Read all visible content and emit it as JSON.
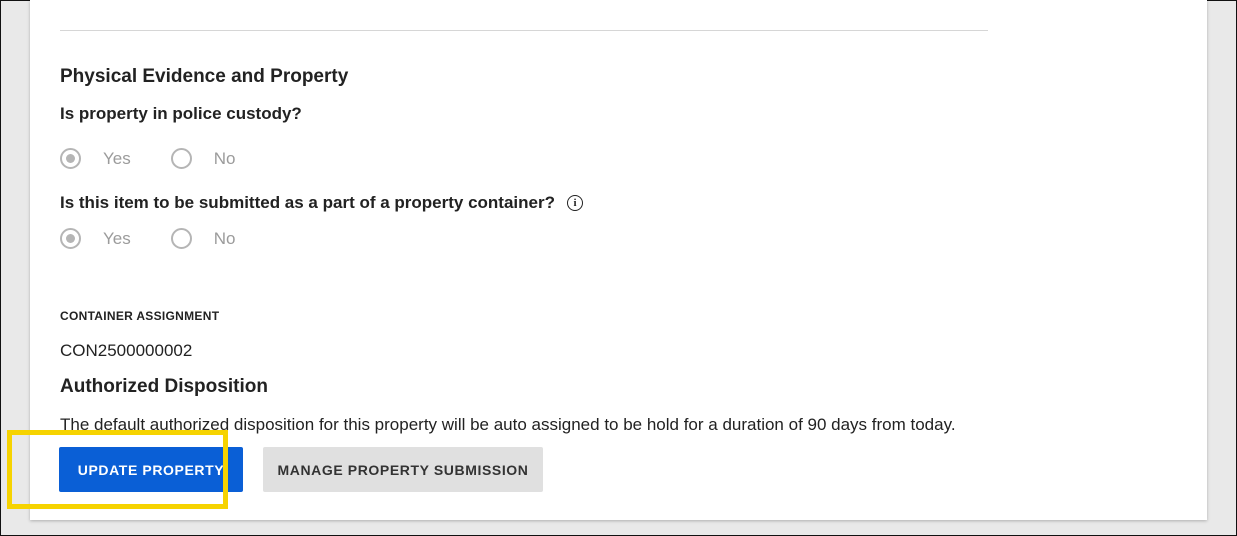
{
  "section1": {
    "title": "Physical Evidence and Property",
    "q1": {
      "label": "Is property in police custody?",
      "options": [
        "Yes",
        "No"
      ],
      "selected": "Yes"
    },
    "q2": {
      "label": "Is this item to be submitted as a part of a property container?",
      "info_icon": "info-icon",
      "options": [
        "Yes",
        "No"
      ],
      "selected": "Yes"
    }
  },
  "container": {
    "label": "CONTAINER ASSIGNMENT",
    "value": "CON2500000002"
  },
  "section2": {
    "title": "Authorized Disposition",
    "description": "The default authorized disposition for this property will be auto assigned to be hold for a duration of 90 days from today."
  },
  "actions": {
    "update_label": "UPDATE PROPERTY",
    "manage_label": "MANAGE PROPERTY SUBMISSION"
  },
  "colors": {
    "primary": "#0a5fd6",
    "secondary": "#e0e0e0",
    "highlight": "#f6d300",
    "disabled_radio": "#b5b5b5"
  }
}
